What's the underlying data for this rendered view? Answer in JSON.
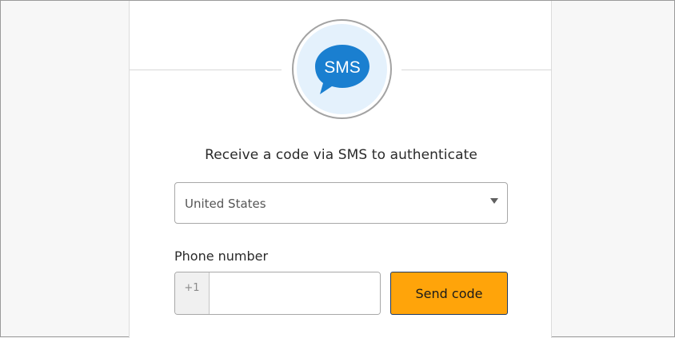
{
  "icon": {
    "name": "sms-chat-bubble-icon",
    "text": "SMS",
    "bubble_color": "#1a7fd0",
    "background_color": "#e4f1fc"
  },
  "heading": "Receive a code via SMS to authenticate",
  "country_select": {
    "selected": "United States"
  },
  "phone": {
    "label": "Phone number",
    "country_code": "+1",
    "value": "",
    "placeholder": ""
  },
  "send_button": {
    "label": "Send code",
    "color": "#ffa40a"
  }
}
